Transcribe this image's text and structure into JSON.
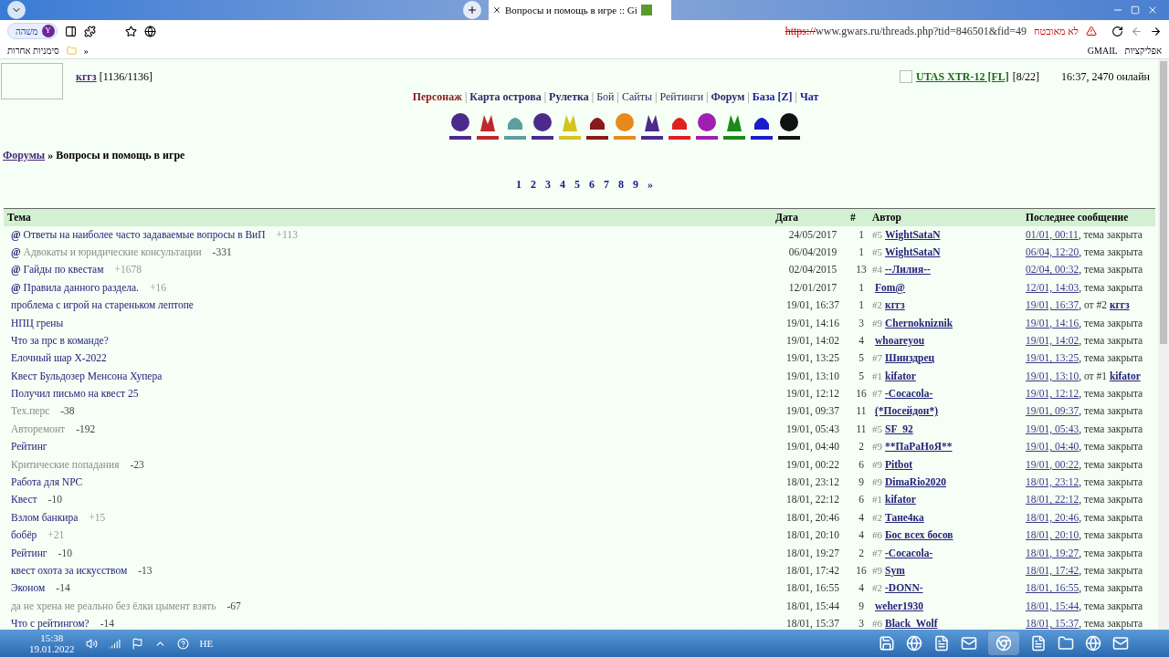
{
  "browser": {
    "tab_title": "Вопросы и помощь в игре :: Gi",
    "profile": {
      "label": "משׁהה",
      "initial": "Y"
    },
    "security": "לא מאובטח",
    "url_scheme": "https://",
    "url_rest": "www.gwars.ru/threads.php?tid=846501&fid=49",
    "bookmarks": [
      "GMAIL",
      "אפליקציות"
    ],
    "other_bookmarks": "סימניות אחרות",
    "more": "»"
  },
  "header": {
    "user": "кггз",
    "user_hp": "[1136/1136]",
    "weapon": "UTAS XTR-12 [FL]",
    "weapon_count": "[8/22]",
    "online": "16:37, 2470 онлайн"
  },
  "nav_separator": "|",
  "nav": [
    {
      "label": "Персонаж",
      "kind": "red"
    },
    {
      "label": "Карта острова",
      "kind": "bold"
    },
    {
      "label": "Рулетка",
      "kind": "bold"
    },
    {
      "label": "Бой",
      "kind": "plain"
    },
    {
      "label": "Сайты",
      "kind": "plain"
    },
    {
      "label": "Рейтинги",
      "kind": "plain"
    },
    {
      "label": "Форум",
      "kind": "bold"
    },
    {
      "label": "База [Z]",
      "kind": "blue"
    },
    {
      "label": "Чат",
      "kind": "blue"
    }
  ],
  "icons": [
    {
      "color": "#4b2a8c"
    },
    {
      "color": "#c0282d"
    },
    {
      "color": "#5e9ea0"
    },
    {
      "color": "#4b2a8c"
    },
    {
      "color": "#d4c41c"
    },
    {
      "color": "#8b1a1a"
    },
    {
      "color": "#e8891c"
    },
    {
      "color": "#4b2a8c"
    },
    {
      "color": "#e02020"
    },
    {
      "color": "#a01fb0"
    },
    {
      "color": "#1a8a1a"
    },
    {
      "color": "#1c1ccc"
    },
    {
      "color": "#111111"
    }
  ],
  "breadcrumb": {
    "root": "Форумы",
    "sep": "»",
    "current": "Вопросы и помощь в игре"
  },
  "pages": [
    "1",
    "2",
    "3",
    "4",
    "5",
    "6",
    "7",
    "8",
    "9",
    "»"
  ],
  "table": {
    "columns": [
      "Тема",
      "Дата",
      "#",
      "Автор",
      "Последнее сообщение"
    ],
    "rows": [
      {
        "pin": "@",
        "topic": "Ответы на наиболее часто задаваемые вопросы в ВиП",
        "muted": false,
        "score": "+113",
        "negative": false,
        "date": "24/05/2017",
        "count": "1",
        "prefix": "#5",
        "author": "WightSataN",
        "last": "01/01, 00:11",
        "last_note": ", тема закрыта"
      },
      {
        "pin": "@",
        "topic": "Адвокаты и юридические консультации",
        "muted": true,
        "score": "-331",
        "negative": true,
        "date": "06/04/2019",
        "count": "1",
        "prefix": "#5",
        "author": "WightSataN",
        "last": "06/04, 12:20",
        "last_note": ", тема закрыта"
      },
      {
        "pin": "@",
        "topic": "Гайды по квестам",
        "muted": false,
        "score": "+1678",
        "negative": false,
        "date": "02/04/2015",
        "count": "13",
        "prefix": "#4",
        "author": "--Лилия--",
        "last": "02/04, 00:32",
        "last_note": ", тема закрыта"
      },
      {
        "pin": "@",
        "topic": "Правила данного раздела.",
        "muted": false,
        "score": "+16",
        "negative": false,
        "date": "12/01/2017",
        "count": "1",
        "author": "Fom@",
        "last": "12/01, 14:03",
        "last_note": ", тема закрыта"
      },
      {
        "topic": "проблема с игрой на стареньком лептопе",
        "muted": false,
        "date": "19/01, 16:37",
        "count": "1",
        "prefix": "#2",
        "author": "кггз",
        "last": "19/01, 16:37",
        "last_note": ", от #2",
        "last_author": "кггз"
      },
      {
        "topic": "НПЦ грены",
        "muted": false,
        "date": "19/01, 14:16",
        "count": "3",
        "prefix": "#9",
        "author": "Chernokniznik",
        "last": "19/01, 14:16",
        "last_note": ", тема закрыта"
      },
      {
        "topic": "Что за прс в команде?",
        "muted": false,
        "date": "19/01, 14:02",
        "count": "4",
        "author": "whoareyou",
        "last": "19/01, 14:02",
        "last_note": ", тема закрыта"
      },
      {
        "topic": "Елочный шар X-2022",
        "muted": false,
        "date": "19/01, 13:25",
        "count": "5",
        "prefix": "#7",
        "author": "Шинздрец",
        "last": "19/01, 13:25",
        "last_note": ", тема закрыта"
      },
      {
        "topic": "Квест Бульдозер Менсона Хупера",
        "muted": false,
        "date": "19/01, 13:10",
        "count": "5",
        "prefix": "#1",
        "author": "kifator",
        "last": "19/01, 13:10",
        "last_note": ", от #1",
        "last_author": "kifator"
      },
      {
        "topic": "Получил письмо на квест 25",
        "muted": false,
        "date": "19/01, 12:12",
        "count": "16",
        "prefix": "#7",
        "author": "-Cocacola-",
        "last": "19/01, 12:12",
        "last_note": ", тема закрыта"
      },
      {
        "topic": "Тех.перс",
        "muted": true,
        "score": "-38",
        "negative": true,
        "date": "19/01, 09:37",
        "count": "11",
        "author": "(*Посейдон*)",
        "last": "19/01, 09:37",
        "last_note": ", тема закрыта"
      },
      {
        "topic": "Авторемонт",
        "muted": true,
        "score": "-192",
        "negative": true,
        "date": "19/01, 05:43",
        "count": "11",
        "prefix": "#5",
        "author": "SF_92",
        "last": "19/01, 05:43",
        "last_note": ", тема закрыта"
      },
      {
        "topic": "Рейтинг",
        "muted": false,
        "date": "19/01, 04:40",
        "count": "2",
        "prefix": "#9",
        "author": "**ПаРаНоЯ**",
        "last": "19/01, 04:40",
        "last_note": ", тема закрыта"
      },
      {
        "topic": "Критические попадания",
        "muted": true,
        "score": "-23",
        "negative": true,
        "date": "19/01, 00:22",
        "count": "6",
        "prefix": "#9",
        "author": "Pitbot",
        "last": "19/01, 00:22",
        "last_note": ", тема закрыта"
      },
      {
        "topic": "Работа для NPC",
        "muted": false,
        "date": "18/01, 23:12",
        "count": "9",
        "prefix": "#9",
        "author": "DimaRio2020",
        "last": "18/01, 23:12",
        "last_note": ", тема закрыта"
      },
      {
        "topic": "Квест",
        "muted": false,
        "score": "-10",
        "negative": true,
        "date": "18/01, 22:12",
        "count": "6",
        "prefix": "#1",
        "author": "kifator",
        "last": "18/01, 22:12",
        "last_note": ", тема закрыта"
      },
      {
        "topic": "Взлом банкира",
        "muted": false,
        "score": "+15",
        "negative": false,
        "date": "18/01, 20:46",
        "count": "4",
        "prefix": "#2",
        "author": "Тане4ка",
        "last": "18/01, 20:46",
        "last_note": ", тема закрыта"
      },
      {
        "topic": "бобёр",
        "muted": false,
        "score": "+21",
        "negative": false,
        "date": "18/01, 20:10",
        "count": "4",
        "prefix": "#6",
        "author": "Бос всех босов",
        "last": "18/01, 20:10",
        "last_note": ", тема закрыта"
      },
      {
        "topic": "Рейтинг",
        "muted": false,
        "score": "-10",
        "negative": true,
        "date": "18/01, 19:27",
        "count": "2",
        "prefix": "#7",
        "author": "-Cocacola-",
        "last": "18/01, 19:27",
        "last_note": ", тема закрыта"
      },
      {
        "topic": "квест охота за искусством",
        "muted": false,
        "score": "-13",
        "negative": true,
        "date": "18/01, 17:42",
        "count": "16",
        "prefix": "#9",
        "author": "Sym",
        "last": "18/01, 17:42",
        "last_note": ", тема закрыта"
      },
      {
        "topic": "Эконом",
        "muted": false,
        "score": "-14",
        "negative": true,
        "date": "18/01, 16:55",
        "count": "4",
        "prefix": "#2",
        "author": "-DONN-",
        "last": "18/01, 16:55",
        "last_note": ", тема закрыта"
      },
      {
        "topic": "да не хрена не реально без ёлки цымент взять",
        "muted": true,
        "score": "-67",
        "negative": true,
        "date": "18/01, 15:44",
        "count": "9",
        "author": "weher1930",
        "last": "18/01, 15:44",
        "last_note": ", тема закрыта"
      },
      {
        "topic": "Что с рейтингом?",
        "muted": false,
        "score": "-14",
        "negative": true,
        "date": "18/01, 15:37",
        "count": "3",
        "prefix": "#6",
        "author": "Black_Wolf",
        "last": "18/01, 15:37",
        "last_note": ", тема закрыта"
      }
    ]
  },
  "taskbar": {
    "time": "15:38",
    "date": "19.01.2022",
    "lang": "HE"
  }
}
